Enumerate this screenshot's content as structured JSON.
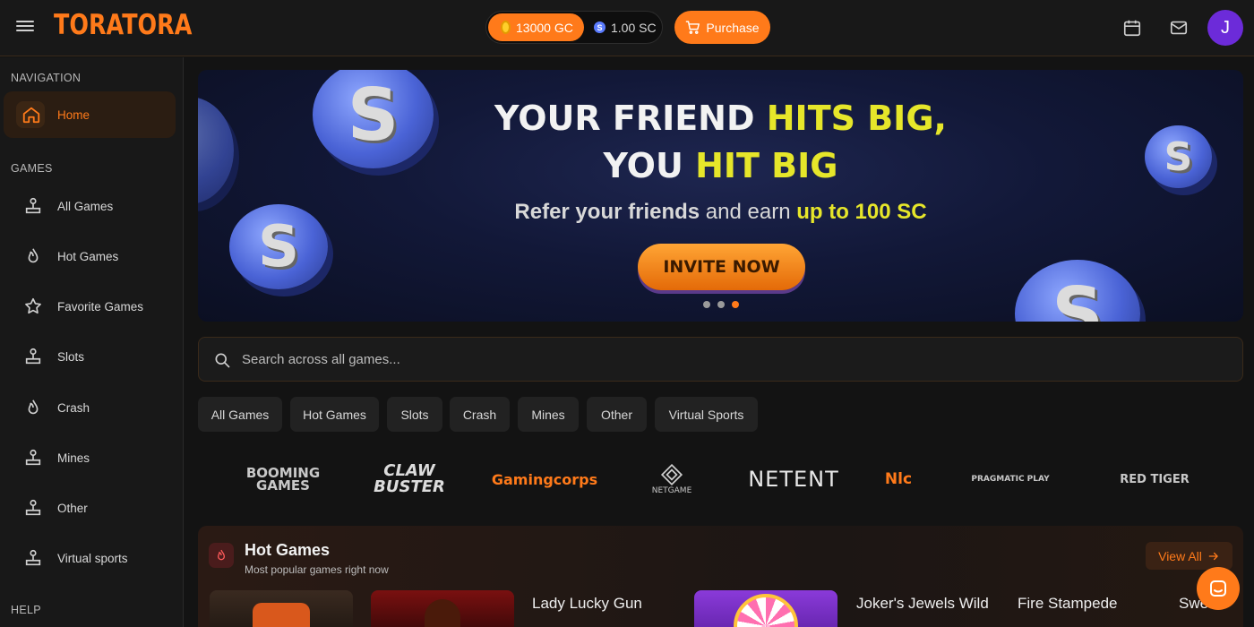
{
  "header": {
    "logo": "TORATORA",
    "gc_balance": "13000 GC",
    "sc_balance": "1.00 SC",
    "sc_coin_letter": "S",
    "purchase_label": "Purchase",
    "avatar_letter": "J",
    "accent_color": "#ff7a1a"
  },
  "sidebar": {
    "navigation_heading": "NAVIGATION",
    "nav_items": [
      {
        "label": "Home",
        "icon": "home-icon",
        "active": true
      }
    ],
    "games_heading": "GAMES",
    "game_items": [
      {
        "label": "All Games",
        "icon": "joystick-icon"
      },
      {
        "label": "Hot Games",
        "icon": "flame-icon"
      },
      {
        "label": "Favorite Games",
        "icon": "star-icon"
      },
      {
        "label": "Slots",
        "icon": "joystick-icon"
      },
      {
        "label": "Crash",
        "icon": "flame-icon"
      },
      {
        "label": "Mines",
        "icon": "joystick-icon"
      },
      {
        "label": "Other",
        "icon": "joystick-icon"
      },
      {
        "label": "Virtual sports",
        "icon": "joystick-icon"
      }
    ],
    "help_heading": "HELP"
  },
  "banner": {
    "line1_a": "YOUR FRIEND ",
    "line1_b": "HITS BIG,",
    "line2_a": "YOU ",
    "line2_b": "HIT BIG",
    "sub_a": "Refer your friends",
    "sub_b": " and earn ",
    "sub_c": "up to 100 SC",
    "cta": "INVITE NOW",
    "coin_letter": "S",
    "active_slide": 3,
    "slide_count": 3
  },
  "search": {
    "placeholder": "Search across all games..."
  },
  "filters": [
    "All Games",
    "Hot Games",
    "Slots",
    "Crash",
    "Mines",
    "Other",
    "Virtual Sports"
  ],
  "providers": [
    {
      "name": "BOOMING GAMES",
      "line1": "BOOMING",
      "line2": "GAMES"
    },
    {
      "name": "CLAW BUSTER",
      "line1": "CLAW",
      "line2": "BUSTER"
    },
    {
      "name": "Gamingcorps",
      "line1": "Gamingcorps"
    },
    {
      "name": "NETGAME",
      "line1": "NETGAME"
    },
    {
      "name": "NETENT",
      "line1": "NETENT"
    },
    {
      "name": "Nlc",
      "line1": "Nlc"
    },
    {
      "name": "PRAGMATIC PLAY",
      "line1": "PRAGMATIC PLAY"
    },
    {
      "name": "RED TIGER",
      "line1": "RED TIGER"
    }
  ],
  "hot_games": {
    "title": "Hot Games",
    "subtitle": "Most popular games right now",
    "view_all": "View All",
    "names": [
      "Lady Lucky Gun",
      "Joker's Jewels Wild",
      "Fire Stampede",
      "Swe"
    ]
  }
}
